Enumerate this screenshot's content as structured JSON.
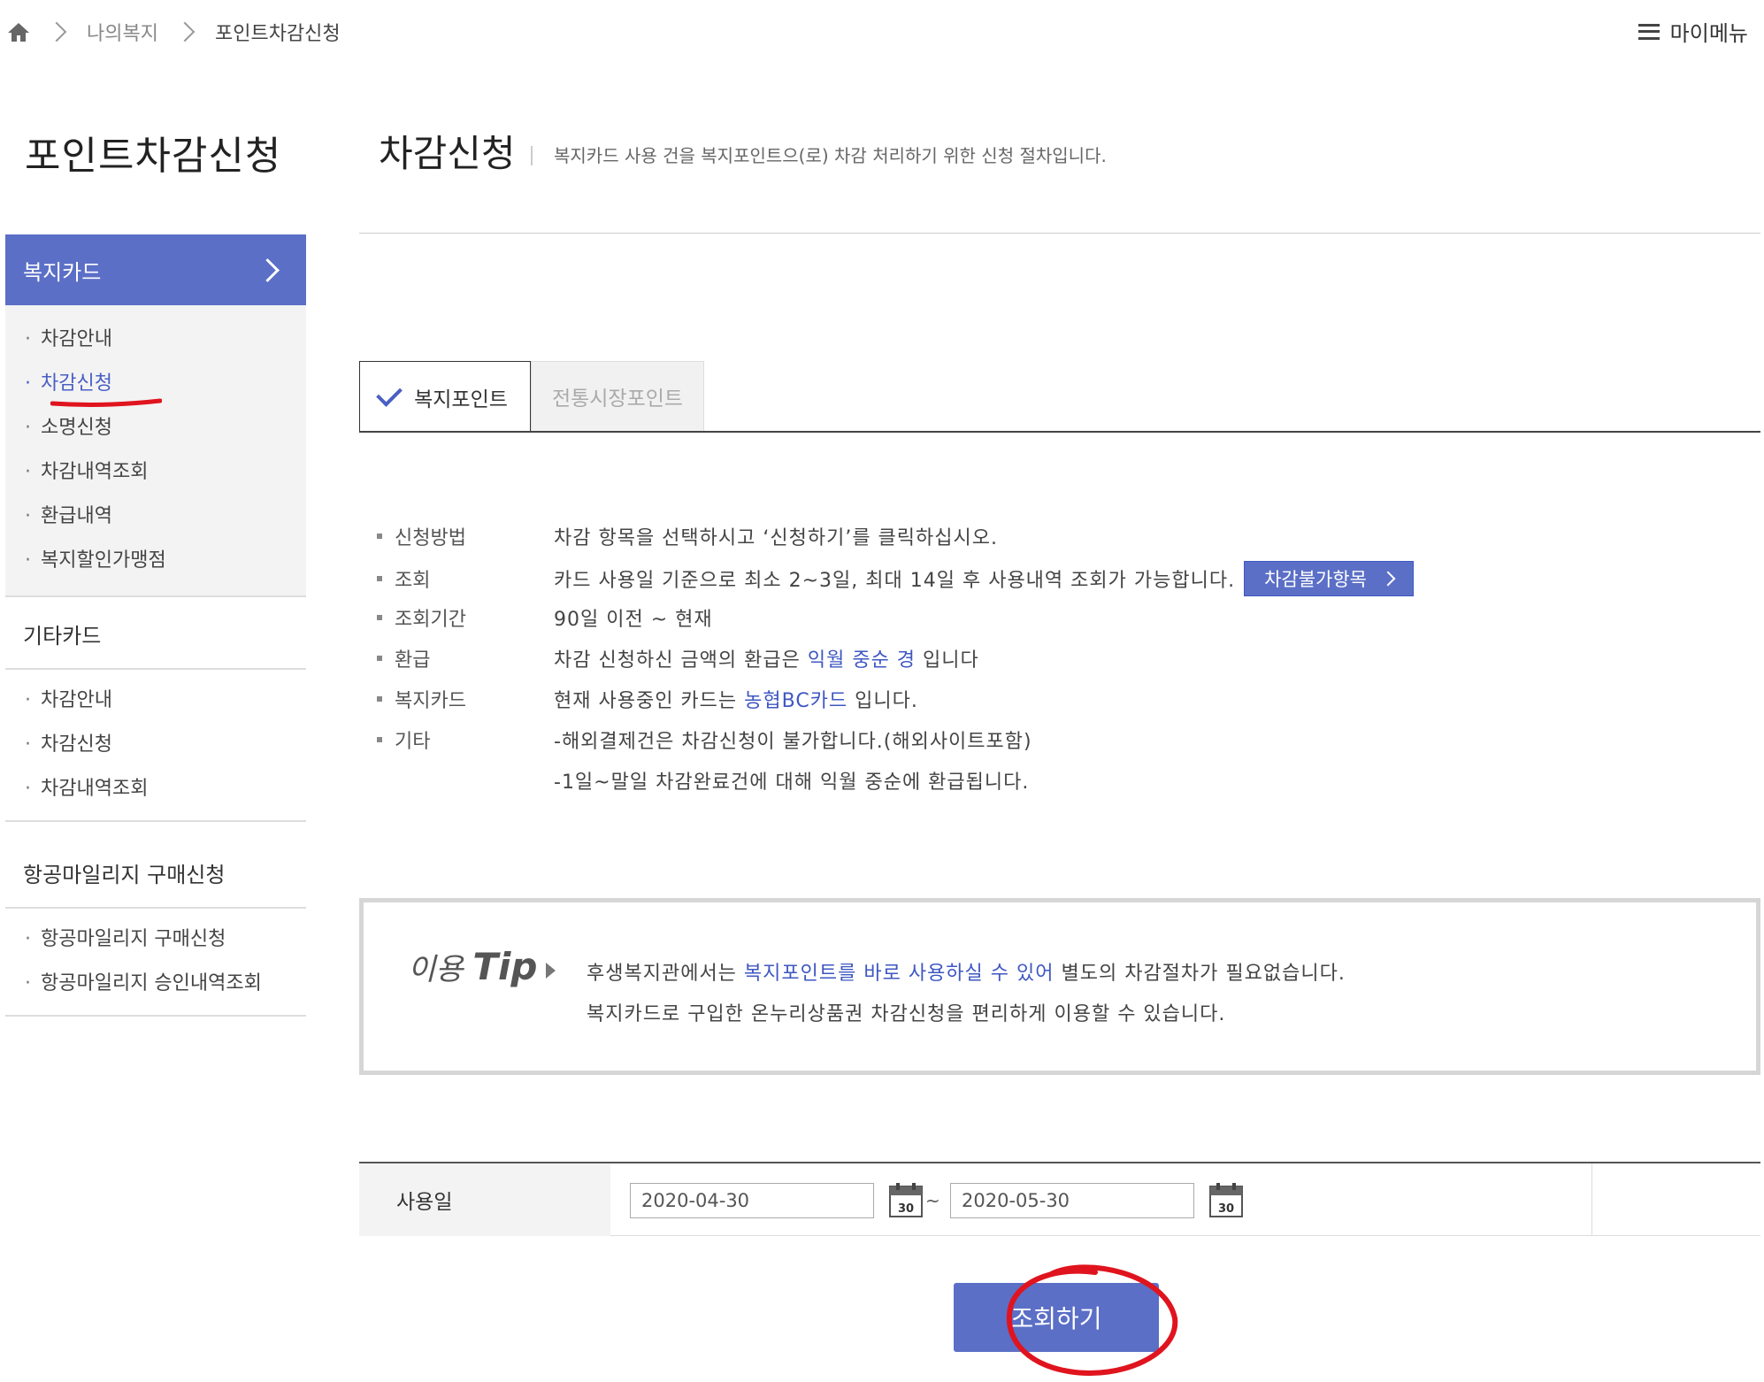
{
  "breadcrumb": {
    "level1": "나의복지",
    "level2": "포인트차감신청"
  },
  "mymenu_label": "마이메뉴",
  "left_title": "포인트차감신청",
  "page_title": "차감신청",
  "page_desc": "복지카드 사용 건을 복지포인트으(로) 차감 처리하기 위한 신청 절차입니다.",
  "sidebar": {
    "active_section": "복지카드",
    "section1_items": [
      "차감안내",
      "차감신청",
      "소명신청",
      "차감내역조회",
      "환급내역",
      "복지할인가맹점"
    ],
    "section2_title": "기타카드",
    "section2_items": [
      "차감안내",
      "차감신청",
      "차감내역조회"
    ],
    "section3_title": "항공마일리지 구매신청",
    "section3_items": [
      "항공마일리지 구매신청",
      "항공마일리지 승인내역조회"
    ]
  },
  "tabs": {
    "active": "복지포인트",
    "inactive": "전통시장포인트"
  },
  "info": {
    "r1_label": "신청방법",
    "r1_value": "차감 항목을 선택하시고 ‘신청하기’를 클릭하십시오.",
    "r2_label": "조회",
    "r2_value": "카드 사용일 기준으로 최소 2~3일, 최대 14일 후 사용내역 조회가 가능합니다.",
    "r2_button": "차감불가항목",
    "r3_label": "조회기간",
    "r3_value": "90일 이전 ~ 현재",
    "r4_label": "환급",
    "r4_pre": "차감 신청하신 금액의 환급은 ",
    "r4_hl": "익월 중순 경",
    "r4_post": " 입니다",
    "r5_label": "복지카드",
    "r5_pre": " 현재 사용중인 카드는 ",
    "r5_hl": "농협BC카드",
    "r5_post": " 입니다.",
    "r6_label": "기타",
    "r6_value": "-해외결제건은 차감신청이 불가합니다.(해외사이트포함)",
    "r7_value": " -1일~말일 차감완료건에 대해 익월 중순에 환급됩니다."
  },
  "tip": {
    "title_pre": "이용 ",
    "title_bold": "Tip",
    "l1_pre": "후생복지관에서는 ",
    "l1_hl": "복지포인트를 바로 사용하실 수 있어",
    "l1_post": " 별도의 차감절차가 필요없습니다.",
    "l2": "복지카드로 구입한 온누리상품권 차감신청을 편리하게 이용할 수 있습니다."
  },
  "form": {
    "label": "사용일",
    "start_date": "2020-04-30",
    "end_date": "2020-05-30",
    "tilde": "~",
    "calendar_day": "30"
  },
  "search_button": "조회하기",
  "colors": {
    "accent": "#5b6fc7",
    "link": "#3e57c2",
    "annotation": "#e0141e"
  }
}
